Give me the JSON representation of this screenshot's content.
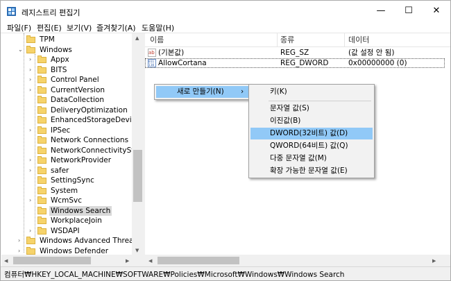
{
  "window": {
    "title": "레지스트리 편집기",
    "minimize_label": "—",
    "maximize_label": "☐",
    "close_label": "✕"
  },
  "menubar": [
    "파일(F)",
    "편집(E)",
    "보기(V)",
    "즐겨찾기(A)",
    "도움말(H)"
  ],
  "tree": {
    "nodes": [
      {
        "label": "TPM",
        "twisty": ""
      },
      {
        "label": "Windows",
        "twisty": "⌄"
      },
      {
        "label": "Appx",
        "twisty": "›"
      },
      {
        "label": "BITS",
        "twisty": "›"
      },
      {
        "label": "Control Panel",
        "twisty": "›"
      },
      {
        "label": "CurrentVersion",
        "twisty": "›"
      },
      {
        "label": "DataCollection",
        "twisty": ""
      },
      {
        "label": "DeliveryOptimization",
        "twisty": ""
      },
      {
        "label": "EnhancedStorageDevices",
        "twisty": ""
      },
      {
        "label": "IPSec",
        "twisty": "›"
      },
      {
        "label": "Network Connections",
        "twisty": ""
      },
      {
        "label": "NetworkConnectivityStatus",
        "twisty": ""
      },
      {
        "label": "NetworkProvider",
        "twisty": "›"
      },
      {
        "label": "safer",
        "twisty": "›"
      },
      {
        "label": "SettingSync",
        "twisty": ""
      },
      {
        "label": "System",
        "twisty": ""
      },
      {
        "label": "WcmSvc",
        "twisty": "›"
      },
      {
        "label": "Windows Search",
        "twisty": "",
        "selected": true
      },
      {
        "label": "WorkplaceJoin",
        "twisty": ""
      },
      {
        "label": "WSDAPI",
        "twisty": "›"
      },
      {
        "label": "Windows Advanced Threat Pro",
        "twisty": "›"
      },
      {
        "label": "Windows Defender",
        "twisty": "›"
      }
    ]
  },
  "list": {
    "columns": [
      "이름",
      "종류",
      "데이터"
    ],
    "rows": [
      {
        "name": "(기본값)",
        "type": "REG_SZ",
        "data": "(값 설정 안 됨)",
        "icon": "string-value-icon"
      },
      {
        "name": "AllowCortana",
        "type": "REG_DWORD",
        "data": "0x00000000 (0)",
        "icon": "binary-value-icon"
      }
    ]
  },
  "context_menu": {
    "new_label": "새로 만들기(N)",
    "arrow": "›"
  },
  "submenu": {
    "key": "키(K)",
    "items": [
      "문자열 값(S)",
      "이진값(B)",
      "DWORD(32비트) 값(D)",
      "QWORD(64비트) 값(Q)",
      "다중 문자열 값(M)",
      "확장 가능한 문자열 값(E)"
    ]
  },
  "status_bar": "컴퓨터₩HKEY_LOCAL_MACHINE₩SOFTWARE₩Policies₩Microsoft₩Windows₩Windows Search",
  "colors": {
    "highlight": "#91c9f7",
    "folder": "#f6d36b"
  }
}
